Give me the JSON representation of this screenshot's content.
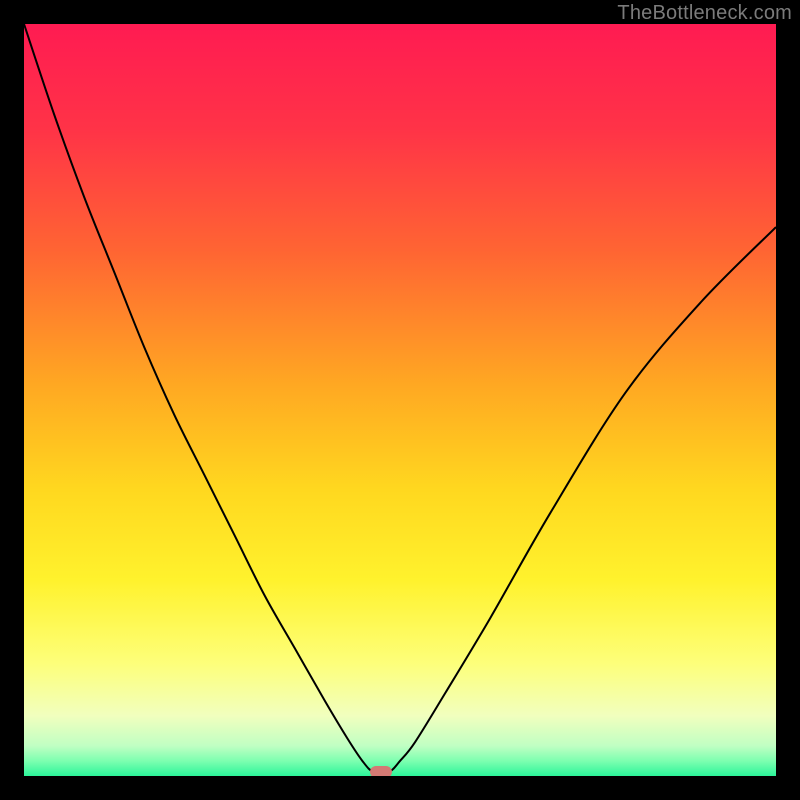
{
  "attribution": "TheBottleneck.com",
  "gradient_stops": [
    {
      "pct": 0,
      "color": "#ff1b52"
    },
    {
      "pct": 14,
      "color": "#ff3347"
    },
    {
      "pct": 30,
      "color": "#ff6433"
    },
    {
      "pct": 48,
      "color": "#ffa822"
    },
    {
      "pct": 62,
      "color": "#ffd81f"
    },
    {
      "pct": 74,
      "color": "#fff22d"
    },
    {
      "pct": 85,
      "color": "#fdff7a"
    },
    {
      "pct": 92,
      "color": "#f1ffbe"
    },
    {
      "pct": 96,
      "color": "#c0ffc3"
    },
    {
      "pct": 98,
      "color": "#7dffb0"
    },
    {
      "pct": 100,
      "color": "#2cf59a"
    }
  ],
  "chart_data": {
    "type": "line",
    "title": "",
    "xlabel": "",
    "ylabel": "",
    "xlim": [
      0,
      100
    ],
    "ylim": [
      0,
      100
    ],
    "grid": false,
    "legend": false,
    "notes": "Single black V-shaped curve over vertical heat gradient background. Minimum near x≈47. y plotted downward from top (0=top, 100=bottom).",
    "series": [
      {
        "name": "bottleneck-curve",
        "color": "#000000",
        "x": [
          0,
          4,
          8,
          12,
          16,
          20,
          24,
          28,
          32,
          36,
          40,
          43,
          45,
          46.5,
          48.5,
          50,
          52,
          56,
          62,
          70,
          80,
          90,
          100
        ],
        "y": [
          0,
          12,
          23,
          33,
          43,
          52,
          60,
          68,
          76,
          83,
          90,
          95,
          98,
          99.5,
          99.5,
          98,
          95.5,
          89,
          79,
          65,
          49,
          37,
          27
        ]
      }
    ],
    "marker": {
      "x": 47.5,
      "y": 99.5,
      "color": "#d47a74"
    }
  }
}
